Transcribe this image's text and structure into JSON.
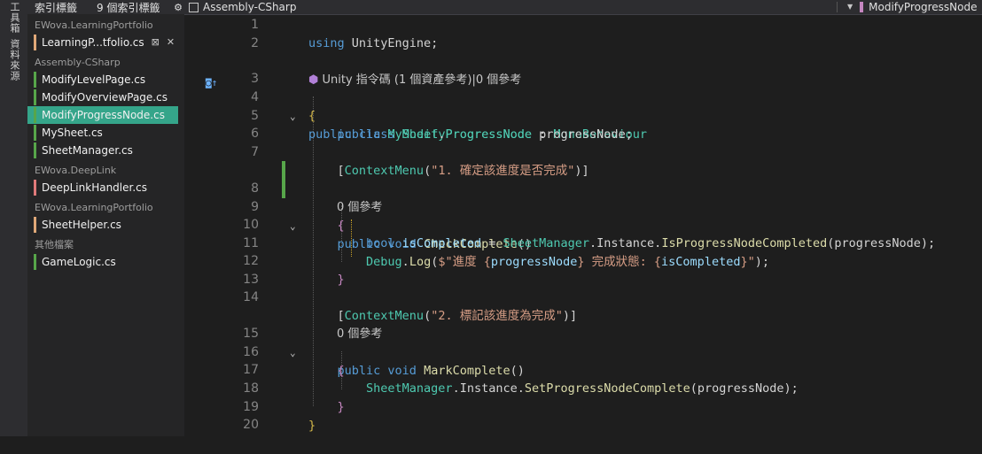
{
  "toolbox": {
    "strip_labels": [
      "工具箱",
      "資料來源"
    ]
  },
  "tab_index": {
    "title": "索引標籤",
    "count_label": "9 個索引標籤",
    "groups": [
      {
        "name": "EWova.LearningPortfolio",
        "items": [
          {
            "label": "LearningP...tfolio.cs",
            "color": "#e0a878",
            "pin": "⊠",
            "close": "✕"
          }
        ]
      },
      {
        "name": "Assembly-CSharp",
        "items": [
          {
            "label": "ModifyLevelPage.cs",
            "color": "#57a64a"
          },
          {
            "label": "ModifyOverviewPage.cs",
            "color": "#57a64a"
          },
          {
            "label": "ModifyProgressNode.cs",
            "color": "#57a64a",
            "selected": true
          },
          {
            "label": "MySheet.cs",
            "color": "#57a64a"
          },
          {
            "label": "SheetManager.cs",
            "color": "#57a64a"
          }
        ]
      },
      {
        "name": "EWova.DeepLink",
        "items": [
          {
            "label": "DeepLinkHandler.cs",
            "color": "#e07a7a"
          }
        ]
      },
      {
        "name": "EWova.LearningPortfolio",
        "items": [
          {
            "label": "SheetHelper.cs",
            "color": "#e0a878"
          }
        ]
      },
      {
        "name": "其他檔案",
        "items": [
          {
            "label": "GameLogic.cs",
            "color": "#57a64a"
          }
        ]
      }
    ]
  },
  "editor_topbar": {
    "project": "Assembly-CSharp",
    "member": "ModifyProgressNode"
  },
  "editor": {
    "line_numbers": [
      "1",
      "2",
      "3",
      "4",
      "5",
      "6",
      "7",
      "8",
      "9",
      "10",
      "11",
      "12",
      "13",
      "14",
      "15",
      "16",
      "17",
      "18",
      "19",
      "20"
    ],
    "lens_class": "Unity 指令碼 (1 個資產參考)|0 個參考",
    "lens_method_1": "0 個參考",
    "lens_method_2": "0 個參考",
    "code": {
      "l1_kw": "using",
      "l1_rest": " UnityEngine;",
      "l3_kw": "public class",
      "l3_cls": "ModifyProgressNode",
      "l3_sep": " : ",
      "l3_base": "MonoBehaviour",
      "l4": "{",
      "l5_kw": "public",
      "l5_ty": "MySheet",
      "l5_dot": ".",
      "l5_ty2": "ProgressNode",
      "l5_rest": " progressNode;",
      "l7_br": "[",
      "l7_attr": "ContextMenu",
      "l7_str": "\"1. 確定該進度是否完成\"",
      "l7_end": ")]",
      "l8_kw": "public void",
      "l8_fn": "CheckComplete",
      "l8_rest": "()",
      "l9": "{",
      "l10_kw": "bool",
      "l10_var": " isCompleted",
      "l10_eq": " = ",
      "l10_ty": "SheetManager",
      "l10_mid": ".Instance.",
      "l10_fn": "IsProgressNodeCompleted",
      "l10_rest": "(progressNode);",
      "l11_ty": "Debug",
      "l11_dot": ".",
      "l11_fn": "Log",
      "l11_open": "(",
      "l11_str1": "$\"進度 {",
      "l11_v1": "progressNode",
      "l11_str2": "} 完成狀態: {",
      "l11_v2": "isCompleted",
      "l11_str3": "}\"",
      "l11_end": ");",
      "l12": "}",
      "l14_br": "[",
      "l14_attr": "ContextMenu",
      "l14_str": "\"2. 標記該進度為完成\"",
      "l14_end": ")]",
      "l15_kw": "public void",
      "l15_fn": "MarkComplete",
      "l15_rest": "()",
      "l16": "{",
      "l17_ty": "SheetManager",
      "l17_mid": ".Instance.",
      "l17_fn": "SetProgressNodeComplete",
      "l17_rest": "(progressNode);",
      "l18": "}",
      "l19": "}"
    }
  }
}
